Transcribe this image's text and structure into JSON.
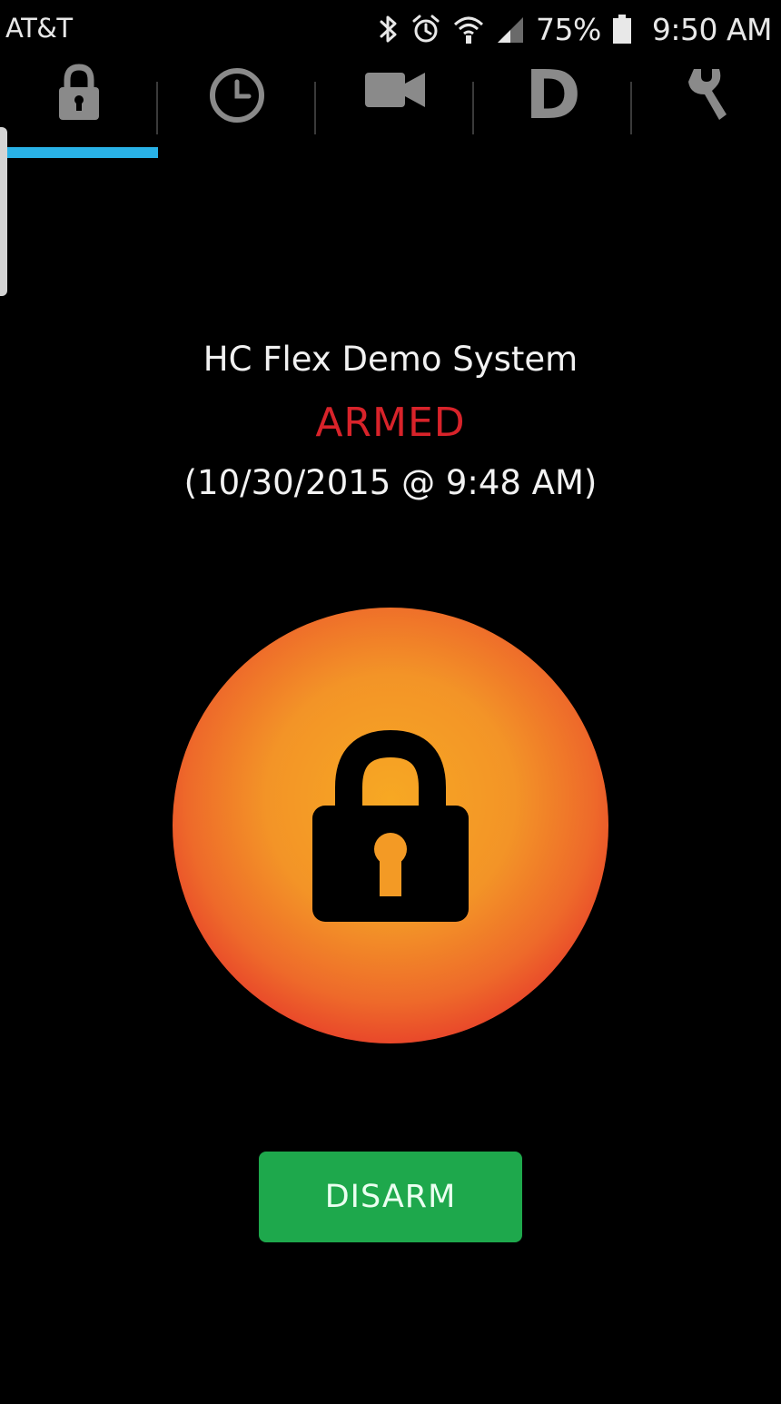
{
  "status_bar": {
    "carrier": "AT&T",
    "battery": "75%",
    "time": "9:50 AM",
    "icons": [
      "bluetooth-icon",
      "alarm-icon",
      "wifi-icon",
      "signal-icon",
      "battery-icon"
    ]
  },
  "tabs": [
    {
      "icon": "lock-icon",
      "selected": true
    },
    {
      "icon": "clock-icon",
      "selected": false
    },
    {
      "icon": "video-camera-icon",
      "selected": false
    },
    {
      "label": "D",
      "icon": "d-logo-icon",
      "selected": false
    },
    {
      "icon": "wrench-icon",
      "selected": false
    }
  ],
  "security": {
    "system_name": "HC Flex Demo System",
    "state": "ARMED",
    "timestamp": "(10/30/2015 @ 9:48 AM)",
    "action_label": "DISARM"
  },
  "colors": {
    "accent_blue": "#29b2e7",
    "armed_red": "#d8232a",
    "disarm_green": "#1ea84c",
    "circle_center": "#f7a823",
    "circle_edge": "#e01f2a"
  }
}
